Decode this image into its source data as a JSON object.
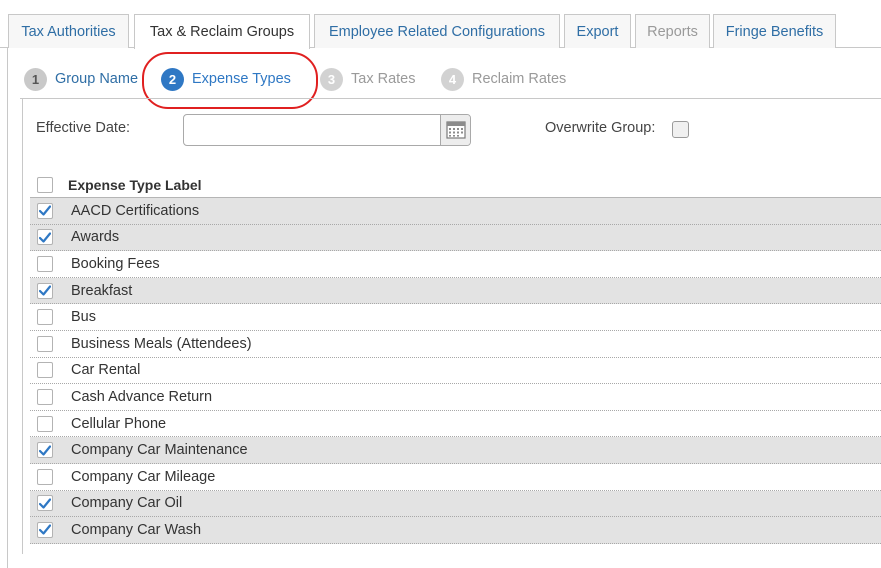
{
  "tabs": [
    {
      "label": "Tax Authorities",
      "state": "normal"
    },
    {
      "label": "Tax & Reclaim Groups",
      "state": "active"
    },
    {
      "label": "Employee Related Configurations",
      "state": "normal"
    },
    {
      "label": "Export",
      "state": "normal"
    },
    {
      "label": "Reports",
      "state": "disabled"
    },
    {
      "label": "Fringe Benefits",
      "state": "normal"
    }
  ],
  "steps": [
    {
      "number": "1",
      "label": "Group Name",
      "state": "done"
    },
    {
      "number": "2",
      "label": "Expense Types",
      "state": "current"
    },
    {
      "number": "3",
      "label": "Tax Rates",
      "state": "todo"
    },
    {
      "number": "4",
      "label": "Reclaim Rates",
      "state": "todo"
    }
  ],
  "form": {
    "effective_date_label": "Effective Date:",
    "effective_date_value": "",
    "overwrite_group_label": "Overwrite Group:",
    "overwrite_group_checked": false
  },
  "list": {
    "header": "Expense Type Label",
    "rows": [
      {
        "label": "AACD Certifications",
        "checked": true
      },
      {
        "label": "Awards",
        "checked": true
      },
      {
        "label": "Booking Fees",
        "checked": false
      },
      {
        "label": "Breakfast",
        "checked": true
      },
      {
        "label": "Bus",
        "checked": false
      },
      {
        "label": "Business Meals (Attendees)",
        "checked": false
      },
      {
        "label": "Car Rental",
        "checked": false
      },
      {
        "label": "Cash Advance Return",
        "checked": false
      },
      {
        "label": "Cellular Phone",
        "checked": false
      },
      {
        "label": "Company Car Maintenance",
        "checked": true
      },
      {
        "label": "Company Car Mileage",
        "checked": false
      },
      {
        "label": "Company Car Oil",
        "checked": true
      },
      {
        "label": "Company Car Wash",
        "checked": true
      }
    ]
  },
  "colors": {
    "link_blue": "#2f6ea5",
    "step_active": "#2f78c4",
    "highlight_ring": "#e02020",
    "selected_row": "#e3e3e3"
  },
  "icons": {
    "calendar": "calendar-icon",
    "checkmark": "checkmark-icon"
  }
}
